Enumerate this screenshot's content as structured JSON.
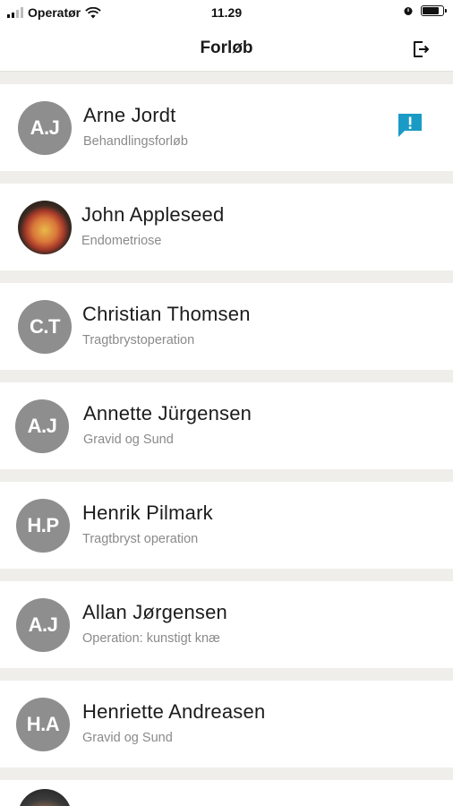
{
  "status_bar": {
    "carrier": "Operatør",
    "time": "11.29"
  },
  "nav": {
    "title": "Forløb",
    "logout_icon": "logout-icon"
  },
  "colors": {
    "accent": "#1a9bc6",
    "avatar_bg": "#8e8e8e",
    "list_bg": "#efeeea"
  },
  "patients": [
    {
      "initials": "A.J",
      "name": "Arne Jordt",
      "course": "Behandlingsforløb",
      "has_message": true
    },
    {
      "initials": "",
      "name": "John Appleseed",
      "course": "Endometriose",
      "photo": true
    },
    {
      "initials": "C.T",
      "name": "Christian Thomsen",
      "course": "Tragtbrystoperation"
    },
    {
      "initials": "A.J",
      "name": "Annette Jürgensen",
      "course": "Gravid og Sund"
    },
    {
      "initials": "H.P",
      "name": "Henrik Pilmark",
      "course": "Tragtbryst operation"
    },
    {
      "initials": "A.J",
      "name": "Allan Jørgensen",
      "course": "Operation: kunstigt knæ"
    },
    {
      "initials": "H.A",
      "name": "Henriette Andreasen",
      "course": "Gravid og Sund"
    }
  ]
}
